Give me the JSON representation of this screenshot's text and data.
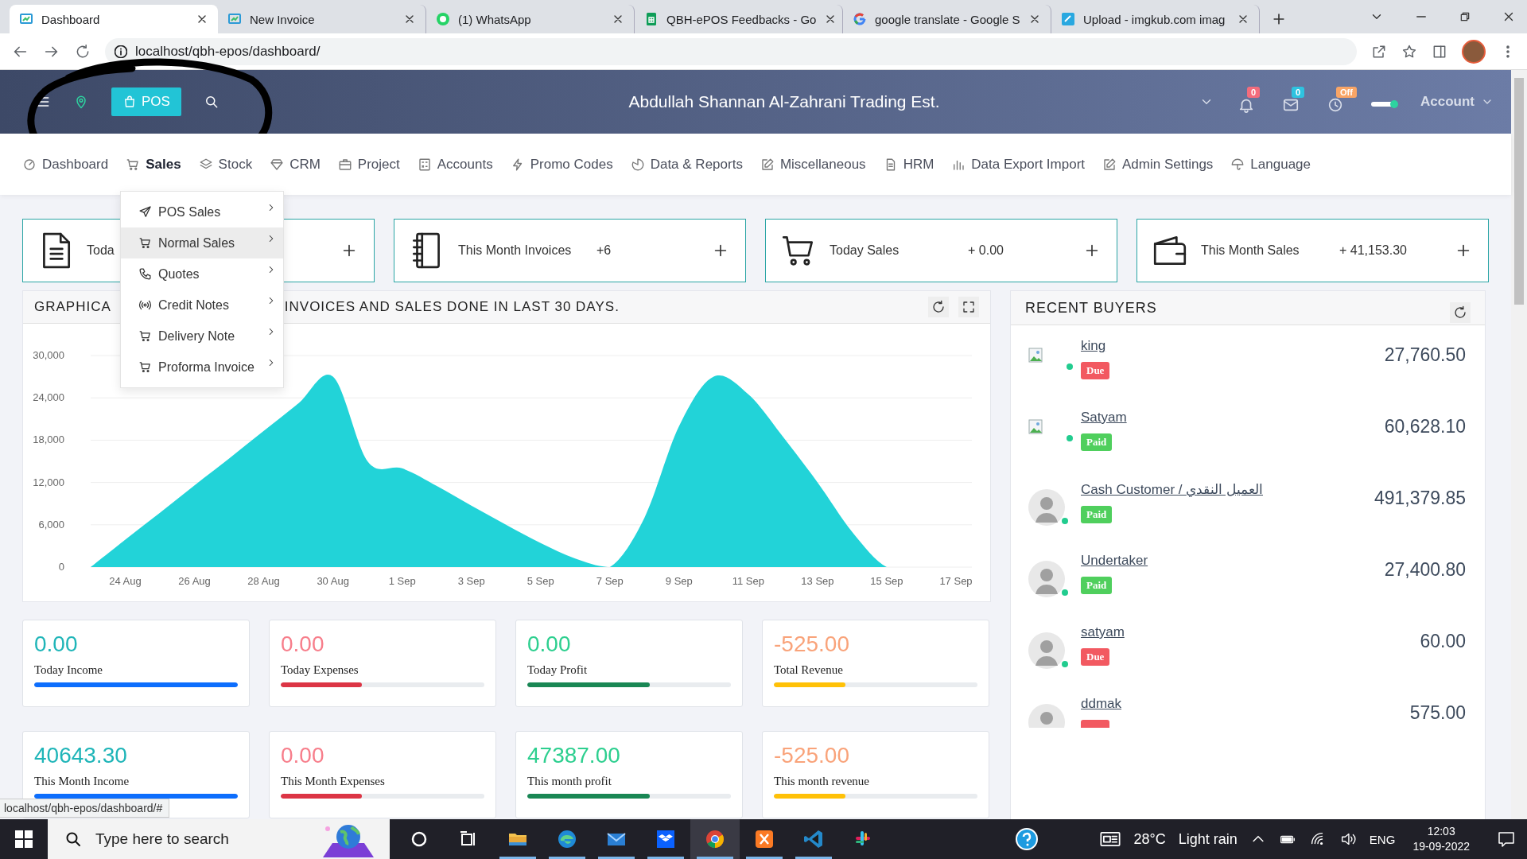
{
  "browser": {
    "tabs": [
      {
        "title": "Dashboard",
        "kind": "app",
        "selected": true
      },
      {
        "title": "New Invoice",
        "kind": "app",
        "selected": false
      },
      {
        "title": "(1) WhatsApp",
        "kind": "whatsapp",
        "selected": false
      },
      {
        "title": "QBH-ePOS Feedbacks - Go",
        "kind": "sheets",
        "selected": false
      },
      {
        "title": "google translate - Google S",
        "kind": "google",
        "selected": false
      },
      {
        "title": "Upload - imgkub.com imag",
        "kind": "upload",
        "selected": false
      }
    ],
    "url": "localhost/qbh-epos/dashboard/"
  },
  "header": {
    "pos_button": "POS",
    "title": "Abdullah Shannan Al-Zahrani Trading Est.",
    "badges": [
      {
        "kind": "bell",
        "count": "0",
        "color": "#f36c7c"
      },
      {
        "kind": "mail",
        "count": "0",
        "color": "#2ec3e0"
      },
      {
        "kind": "clock",
        "count": "Off",
        "color": "#f9a566"
      }
    ],
    "account": "Account"
  },
  "nav": [
    {
      "label": "Dashboard",
      "kind": "gauge",
      "selected": false
    },
    {
      "label": "Sales",
      "kind": "cart",
      "selected": true
    },
    {
      "label": "Stock",
      "kind": "layers",
      "selected": false
    },
    {
      "label": "CRM",
      "kind": "diamond",
      "selected": false
    },
    {
      "label": "Project",
      "kind": "briefcase",
      "selected": false
    },
    {
      "label": "Accounts",
      "kind": "calc",
      "selected": false
    },
    {
      "label": "Promo Codes",
      "kind": "bolt",
      "selected": false
    },
    {
      "label": "Data & Reports",
      "kind": "pie",
      "selected": false
    },
    {
      "label": "Miscellaneous",
      "kind": "edit",
      "selected": false
    },
    {
      "label": "HRM",
      "kind": "doc",
      "selected": false
    },
    {
      "label": "Data Export Import",
      "kind": "bars",
      "selected": false
    },
    {
      "label": "Admin Settings",
      "kind": "edit",
      "selected": false
    },
    {
      "label": "Language",
      "kind": "umbrella",
      "selected": false
    }
  ],
  "sales_menu": [
    {
      "label": "POS Sales",
      "kind": "send",
      "selected": false
    },
    {
      "label": "Normal Sales",
      "kind": "cart",
      "selected": true
    },
    {
      "label": "Quotes",
      "kind": "phone",
      "selected": false
    },
    {
      "label": "Credit Notes",
      "kind": "broadcast",
      "selected": false
    },
    {
      "label": "Delivery Note",
      "kind": "cart",
      "selected": false
    },
    {
      "label": "Proforma Invoice",
      "kind": "cart",
      "selected": false
    }
  ],
  "summary_cards": [
    {
      "label": "Toda",
      "kind": "document"
    },
    {
      "label": "This Month Invoices",
      "value": "+6",
      "kind": "notebook"
    },
    {
      "label": "Today Sales",
      "value": "+ 0.00",
      "kind": "cart"
    },
    {
      "label": "This Month Sales",
      "value": "+ 41,153.30",
      "kind": "wallet"
    }
  ],
  "chart_panel": {
    "title_start": "GRAPHICA",
    "title_end": "INVOICES AND SALES DONE IN LAST 30 DAYS.",
    "chart_data": {
      "type": "area",
      "grid": true,
      "categories": [
        null,
        "24 Aug",
        null,
        "26 Aug",
        null,
        "28 Aug",
        null,
        "30 Aug",
        null,
        "1 Sep",
        null,
        "3 Sep",
        null,
        "5 Sep",
        null,
        "7 Sep",
        null,
        "9 Sep",
        null,
        "11 Sep",
        null,
        "13 Sep",
        null,
        "15 Sep",
        null,
        "17 Sep"
      ],
      "series": [
        {
          "color": "#22d3d8",
          "values": [
            0,
            3900,
            7700,
            11600,
            15400,
            19300,
            23200,
            27000,
            15000,
            14000,
            11500,
            8700,
            6000,
            3400,
            1200,
            0,
            7000,
            20000,
            27000,
            24500,
            18500,
            12000,
            5000,
            0,
            0,
            0
          ]
        }
      ],
      "ylim": [
        0,
        30000
      ],
      "yticks": [
        {
          "value": 0,
          "label": "0"
        },
        {
          "value": 6000,
          "label": "6,000"
        },
        {
          "value": 12000,
          "label": "12,000"
        },
        {
          "value": 18000,
          "label": "18,000"
        },
        {
          "value": 24000,
          "label": "24,000"
        },
        {
          "value": 30000,
          "label": "30,000"
        }
      ]
    }
  },
  "stats": [
    {
      "value": "0.00",
      "label": "Today Income",
      "kind": "income",
      "level": 1.0
    },
    {
      "value": "0.00",
      "label": "Today Expenses",
      "kind": "expenses",
      "level": 0.4
    },
    {
      "value": "0.00",
      "label": "Today Profit",
      "kind": "profit",
      "level": 0.6
    },
    {
      "value": "-525.00",
      "label": "Total Revenue",
      "kind": "revenue",
      "level": 0.35
    },
    {
      "value": "40643.30",
      "label": "This Month Income",
      "kind": "income",
      "level": 1.0
    },
    {
      "value": "0.00",
      "label": "This Month Expenses",
      "kind": "expenses",
      "level": 0.4
    },
    {
      "value": "47387.00",
      "label": "This month profit",
      "kind": "profit",
      "level": 0.6
    },
    {
      "value": "-525.00",
      "label": "This month revenue",
      "kind": "revenue",
      "level": 0.35
    }
  ],
  "recent_buyers": {
    "title": "RECENT BUYERS",
    "buyers": [
      {
        "name": "king",
        "kind": "broken",
        "online": true,
        "color": "#f25961",
        "badge": "Due",
        "amount": "27,760.50"
      },
      {
        "name": "Satyam",
        "kind": "broken",
        "online": true,
        "color": "#4fcf5d",
        "badge": "Paid",
        "amount": "60,628.10"
      },
      {
        "name": "Cash Customer / العميل النقدي",
        "kind": "silhouette",
        "online": true,
        "color": "#4fcf5d",
        "badge": "Paid",
        "amount": "491,379.85"
      },
      {
        "name": "Undertaker",
        "kind": "silhouette",
        "online": true,
        "color": "#4fcf5d",
        "badge": "Paid",
        "amount": "27,400.80"
      },
      {
        "name": "satyam",
        "kind": "silhouette",
        "online": true,
        "color": "#f25961",
        "badge": "Due",
        "amount": "60.00"
      },
      {
        "name": "ddmak",
        "kind": "silhouette",
        "online": false,
        "color": "#f25961",
        "amount": "575.00"
      }
    ]
  },
  "status_link": "localhost/qbh-epos/dashboard/#",
  "taskbar": {
    "search_placeholder": "Type here to search",
    "apps": [
      {
        "kind": "cortana",
        "running": false,
        "selected": false
      },
      {
        "kind": "taskview",
        "running": false,
        "selected": false
      },
      {
        "kind": "folder",
        "running": true,
        "selected": false
      },
      {
        "kind": "edge",
        "running": true,
        "selected": false
      },
      {
        "kind": "mail",
        "running": true,
        "selected": false
      },
      {
        "kind": "dropbox",
        "running": true,
        "selected": false
      },
      {
        "kind": "chrome",
        "running": true,
        "selected": true
      },
      {
        "kind": "xampp",
        "running": true,
        "selected": false
      },
      {
        "kind": "vscode",
        "running": true,
        "selected": false
      },
      {
        "kind": "slack",
        "running": false,
        "selected": false
      }
    ],
    "temperature": "28°C",
    "condition": "Light rain",
    "language": "ENG",
    "time": "12:03",
    "date": "19-09-2022"
  }
}
